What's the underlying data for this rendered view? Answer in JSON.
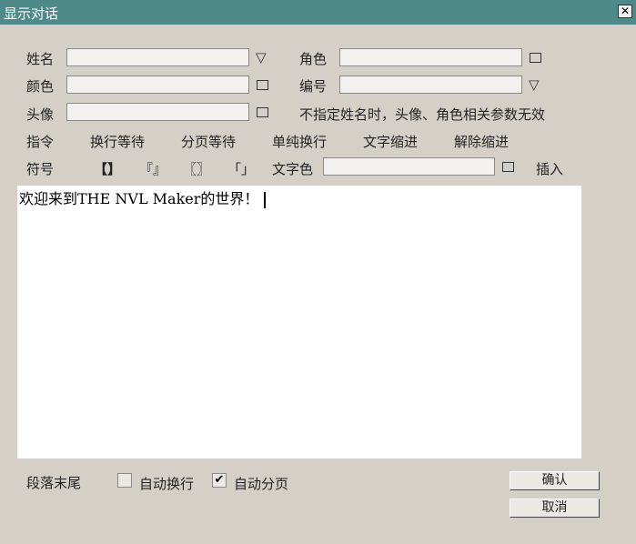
{
  "window": {
    "title": "显示对话",
    "close_glyph": "✕"
  },
  "form": {
    "name_label": "姓名",
    "role_label": "角色",
    "color_label": "颜色",
    "number_label": "编号",
    "avatar_label": "头像",
    "hint_text": "不指定姓名时，头像、角色相关参数无效",
    "text_color_label": "文字色"
  },
  "commands": {
    "label": "指令",
    "items": [
      "换行等待",
      "分页等待",
      "单纯换行",
      "文字缩进",
      "解除缩进"
    ]
  },
  "symbols": {
    "label": "符号",
    "items": [
      "【】",
      "『』",
      "〖〗",
      "「」"
    ],
    "insert_label": "插入"
  },
  "editor": {
    "text": "欢迎来到THE NVL Maker的世界！"
  },
  "footer": {
    "para_end_label": "段落末尾",
    "auto_newline_label": "自动换行",
    "auto_newline_checked": false,
    "auto_page_label": "自动分页",
    "auto_page_checked": true,
    "check_glyph": "✔",
    "confirm_label": "确认",
    "cancel_label": "取消"
  },
  "colors": {
    "titlebar": "#4e8a8a",
    "background": "#d4d0c8"
  }
}
